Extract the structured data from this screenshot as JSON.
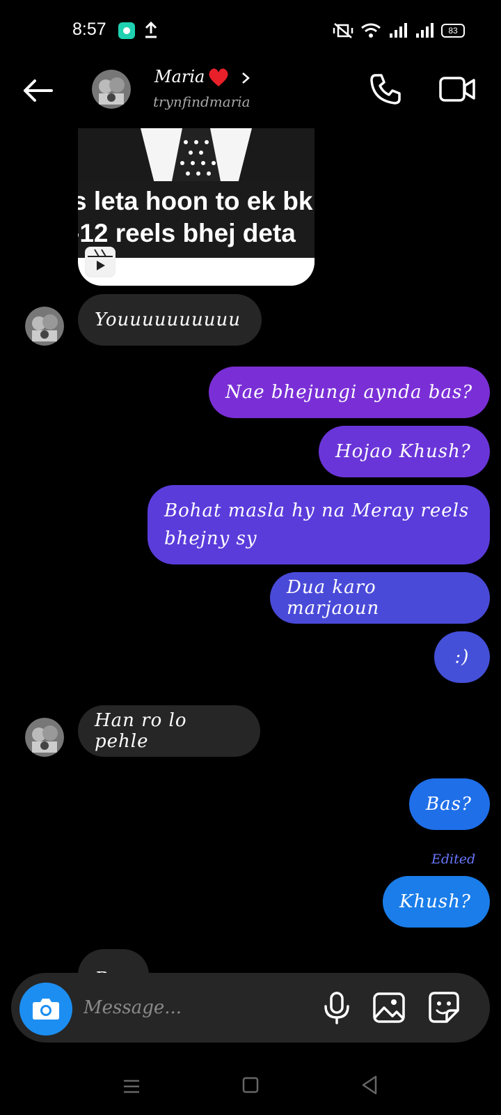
{
  "status_bar": {
    "time": "8:57",
    "battery": "83",
    "icons": [
      "app-notification-icon",
      "upload-icon",
      "vibrate-mute-icon",
      "wifi-icon",
      "signal-icon",
      "signal-icon",
      "battery-icon"
    ]
  },
  "header": {
    "contact_name": "Maria",
    "contact_emoji_icon": "red-heart-icon",
    "username": "trynfindmaria",
    "icons": [
      "back-arrow-icon",
      "chevron-right-icon",
      "phone-icon",
      "video-camera-icon"
    ]
  },
  "reel": {
    "caption_line1": "s leta hoon to ek bk",
    "caption_line2": "-12 reels bhej deta",
    "icon": "reel-icon"
  },
  "messages": [
    {
      "side": "in",
      "text": "Youuuuuuuuuu"
    },
    {
      "side": "out",
      "text": "Nae bhejungi aynda bas?",
      "color": "#7a2fd6"
    },
    {
      "side": "out",
      "text": "Hojao Khush?",
      "color": "#6a35d8"
    },
    {
      "side": "out",
      "text_line1": "Bohat masla hy na Meray reels",
      "text_line2": "bhejny sy",
      "color": "#5a3cdb"
    },
    {
      "side": "out",
      "text": "Dua karo marjaoun",
      "color": "#4a4ad9"
    },
    {
      "side": "out",
      "text": ":)",
      "color": "#4450d8"
    },
    {
      "side": "in",
      "text": "Han ro lo pehle"
    },
    {
      "side": "out",
      "text": "Bas?",
      "color": "#1f6fe8"
    },
    {
      "side": "out",
      "text": "Khush?",
      "color": "#1a7de9",
      "edited_label": "Edited"
    },
    {
      "side": "in",
      "text": "Bas"
    }
  ],
  "composer": {
    "placeholder": "Message...",
    "icons": [
      "camera-icon",
      "microphone-icon",
      "gallery-icon",
      "sticker-icon"
    ],
    "camera_color": "#1c8ef2"
  },
  "navbar": {
    "icons": [
      "menu-icon",
      "home-square-icon",
      "back-triangle-icon"
    ]
  }
}
